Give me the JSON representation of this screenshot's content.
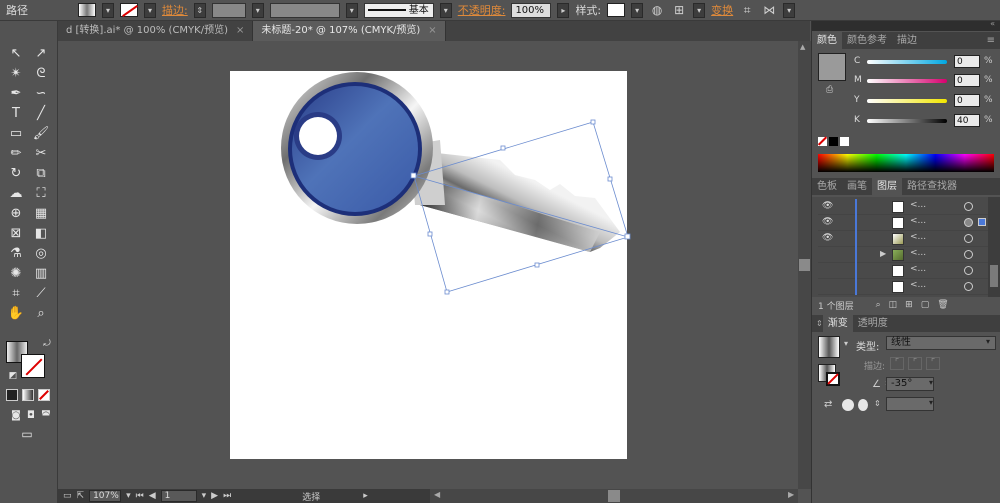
{
  "control_bar": {
    "mode_label": "路径",
    "stroke_label": "描边:",
    "stroke_profile": "基本",
    "opacity_label": "不透明度:",
    "opacity_value": "100%",
    "style_label": "样式:",
    "transform_label": "变换"
  },
  "tabs": [
    {
      "label": "d [转换].ai* @ 100% (CMYK/预览)",
      "close": "×"
    },
    {
      "label": "未标题-20* @ 107% (CMYK/预览)",
      "close": "×"
    }
  ],
  "color_panel": {
    "tabs": [
      "颜色",
      "颜色参考",
      "描边"
    ],
    "channels": [
      {
        "name": "C",
        "value": "0"
      },
      {
        "name": "M",
        "value": "0"
      },
      {
        "name": "Y",
        "value": "0"
      },
      {
        "name": "K",
        "value": "40"
      }
    ],
    "unit": "%"
  },
  "layers_panel": {
    "tabs": [
      "色板",
      "画笔",
      "图层",
      "路径查找器"
    ],
    "rows": [
      {
        "name": "<..."
      },
      {
        "name": "<..."
      },
      {
        "name": "<..."
      },
      {
        "name": "<..."
      },
      {
        "name": "<..."
      },
      {
        "name": "<..."
      }
    ],
    "footer": "1 个图层"
  },
  "gradient_panel": {
    "tabs": [
      "渐变",
      "透明度"
    ],
    "type_label": "类型:",
    "type_value": "线性",
    "stroke_label": "描边:",
    "angle_value": "-35°"
  },
  "status_bar": {
    "zoom": "107%",
    "page": "1",
    "tool": "选择"
  },
  "colors": {
    "key_blue": "#3a5aa8",
    "chrome": "#b0b0b0",
    "selection": "#6b8ccf"
  }
}
